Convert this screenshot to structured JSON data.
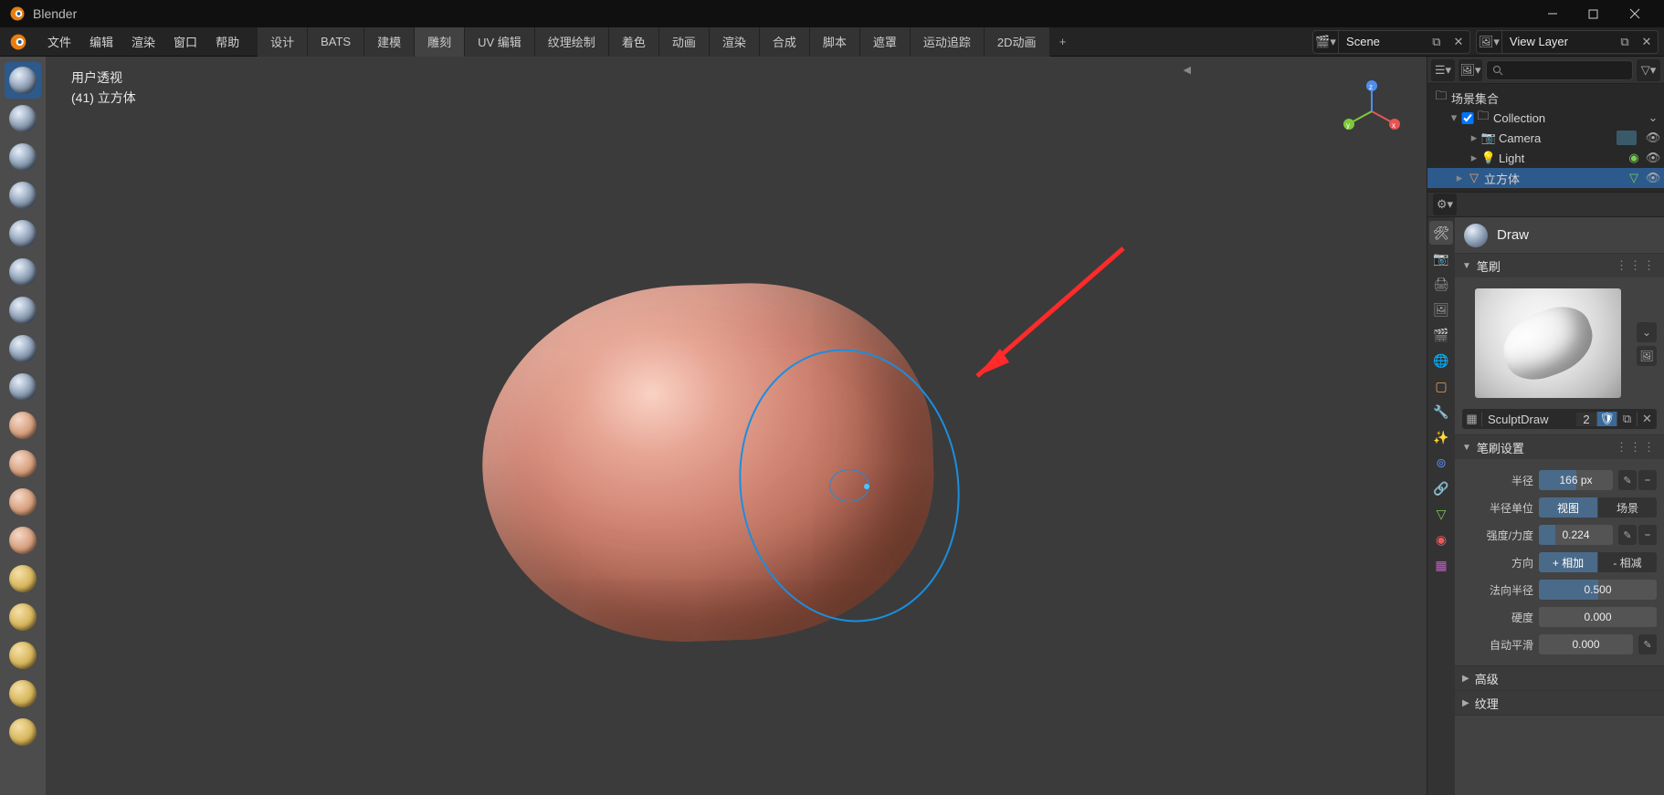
{
  "app": {
    "title": "Blender"
  },
  "menubar": {
    "items": [
      "文件",
      "编辑",
      "渲染",
      "窗口",
      "帮助"
    ],
    "tabs": [
      "设计",
      "BATS",
      "建模",
      "雕刻",
      "UV 编辑",
      "纹理绘制",
      "着色",
      "动画",
      "渲染",
      "合成",
      "脚本",
      "遮罩",
      "运动追踪",
      "2D动画"
    ],
    "scene_label": "Scene",
    "viewlayer_label": "View Layer"
  },
  "viewport": {
    "overlay_line1": "用户透视",
    "overlay_line2": "(41) 立方体"
  },
  "outliner": {
    "scene_collection": "场景集合",
    "collection": "Collection",
    "camera": "Camera",
    "light": "Light",
    "cube": "立方体"
  },
  "tool": {
    "name": "Draw",
    "brush_panel": "笔刷",
    "brush_name": "SculptDraw",
    "brush_users": "2",
    "settings_panel": "笔刷设置",
    "radius_label": "半径",
    "radius_value": "166 px",
    "radius_unit_label": "半径单位",
    "unit_view": "视图",
    "unit_scene": "场景",
    "strength_label": "强度/力度",
    "strength_value": "0.224",
    "direction_label": "方向",
    "dir_add": "+ 相加",
    "dir_sub": "- 相减",
    "normal_radius_label": "法向半径",
    "normal_radius_value": "0.500",
    "hardness_label": "硬度",
    "hardness_value": "0.000",
    "autosmooth_label": "自动平滑",
    "autosmooth_value": "0.000",
    "advanced_panel": "高级",
    "texture_panel": "纹理"
  }
}
